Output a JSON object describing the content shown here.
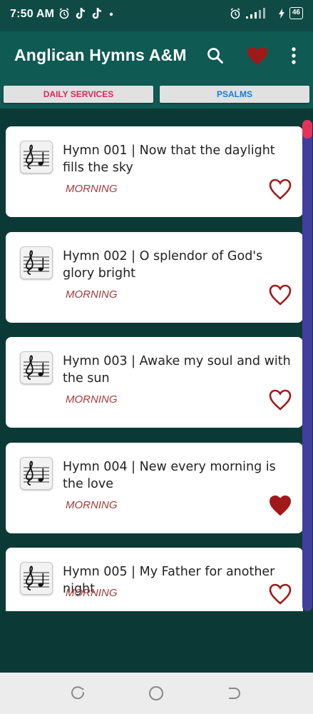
{
  "status_bar": {
    "time": "7:50 AM",
    "left_icons": [
      "alarm-icon",
      "tiktok-icon",
      "tiktok-icon",
      "dot-icon"
    ],
    "right_icons": [
      "alarm-icon",
      "signal-icon",
      "charging-icon"
    ],
    "battery": "46"
  },
  "app_bar": {
    "title": "Anglican Hymns A&M",
    "background": "#0f5a53",
    "favorite_color": "#a01919"
  },
  "tabs": [
    {
      "label": "DAILY SERVICES",
      "color": "#e0245e"
    },
    {
      "label": "PSALMS",
      "color": "#1a7bd6"
    }
  ],
  "hymns": [
    {
      "title": "Hymn 001 | Now that the daylight fills the sky",
      "category": "MORNING",
      "favorite": false
    },
    {
      "title": "Hymn 002 | O splendor of God's glory bright",
      "category": "MORNING",
      "favorite": false
    },
    {
      "title": "Hymn 003 | Awake my soul and with the sun",
      "category": "MORNING",
      "favorite": false
    },
    {
      "title": "Hymn 004 | New every morning is the love",
      "category": "MORNING",
      "favorite": true
    },
    {
      "title": "Hymn 005 | My Father for another night",
      "category": "MORNING",
      "favorite": false
    }
  ],
  "nav_bar": {
    "buttons": [
      "recents-icon",
      "home-icon",
      "back-icon"
    ]
  }
}
